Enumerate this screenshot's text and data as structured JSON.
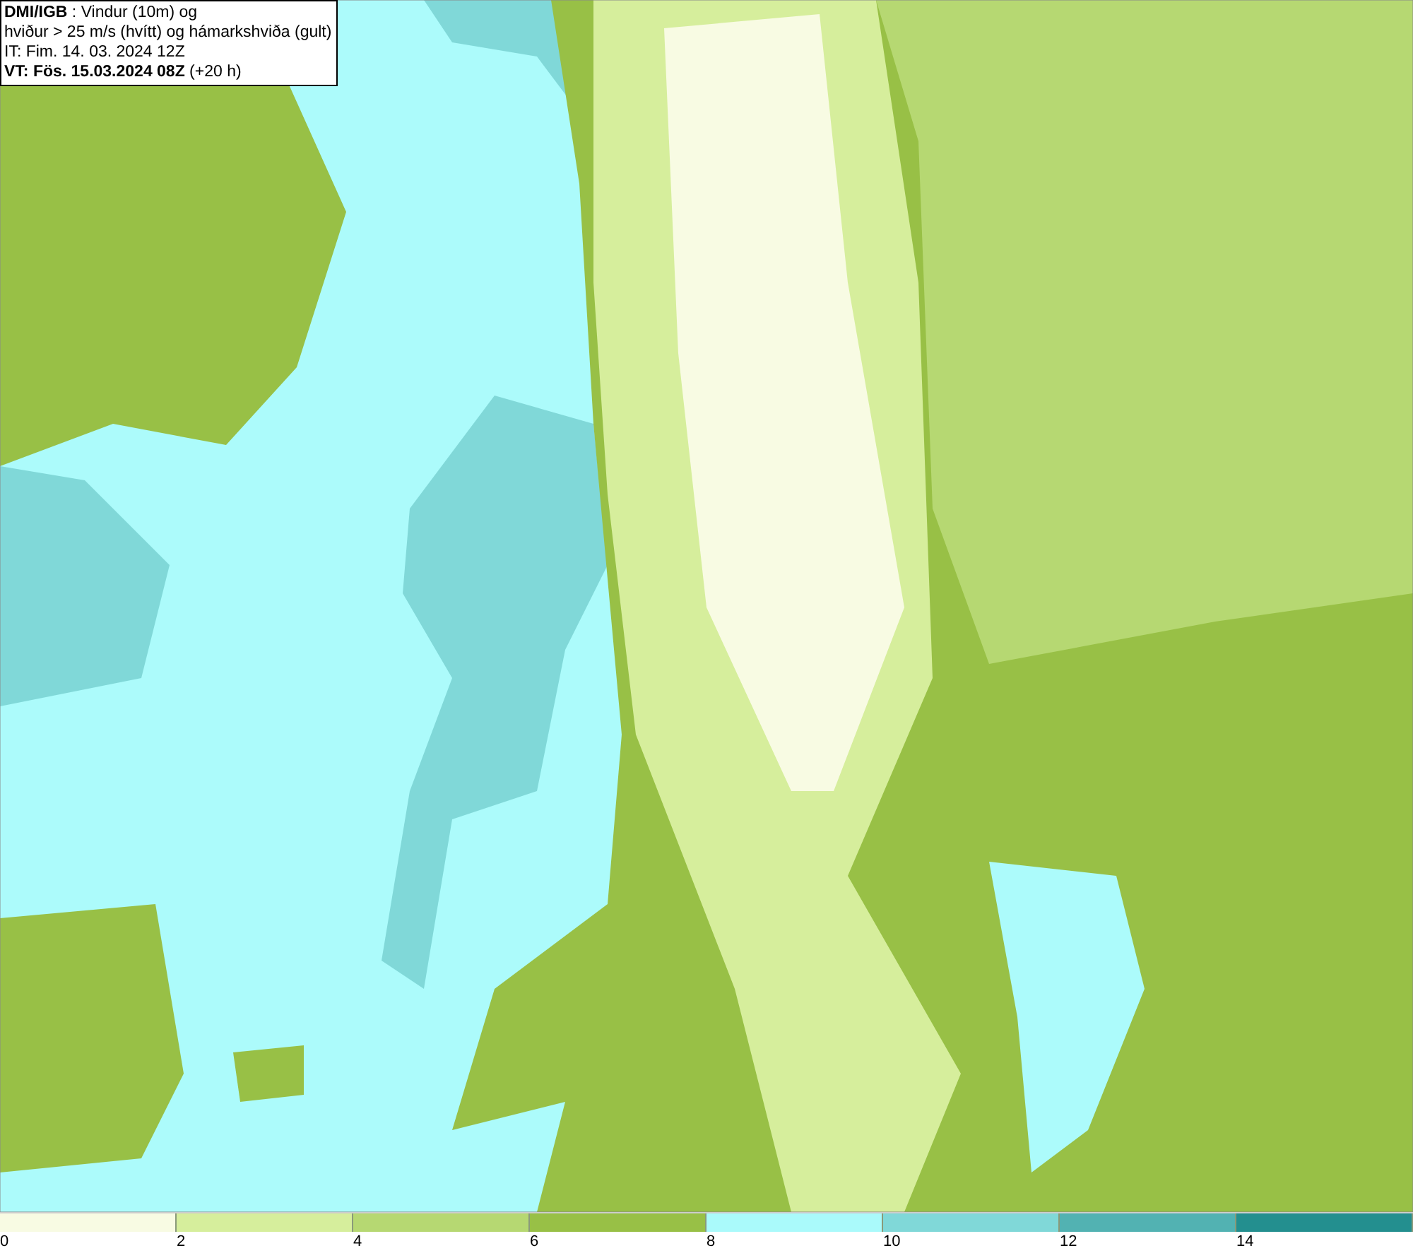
{
  "title_box": {
    "lines": [
      "**DMI/IGB** : Vindur (10m) og",
      "hviður > 25 m/s (hvítt) og hámarkshviða (gult)",
      "IT: Fim. 14. 03. 2024 12Z",
      "**VT: Fös. 15.03.2024 08Z** (+20 h)"
    ]
  },
  "legend": [
    {
      "label": "0",
      "color": "#f8fbe3"
    },
    {
      "label": "2",
      "color": "#d6ee9c"
    },
    {
      "label": "4",
      "color": "#b6d872"
    },
    {
      "label": "6",
      "color": "#98c046"
    },
    {
      "label": "8",
      "color": "#aafafb"
    },
    {
      "label": "10",
      "color": "#80d8d8"
    },
    {
      "label": "12",
      "color": "#52b2b2"
    },
    {
      "label": "14",
      "color": "#238f8f"
    }
  ]
}
